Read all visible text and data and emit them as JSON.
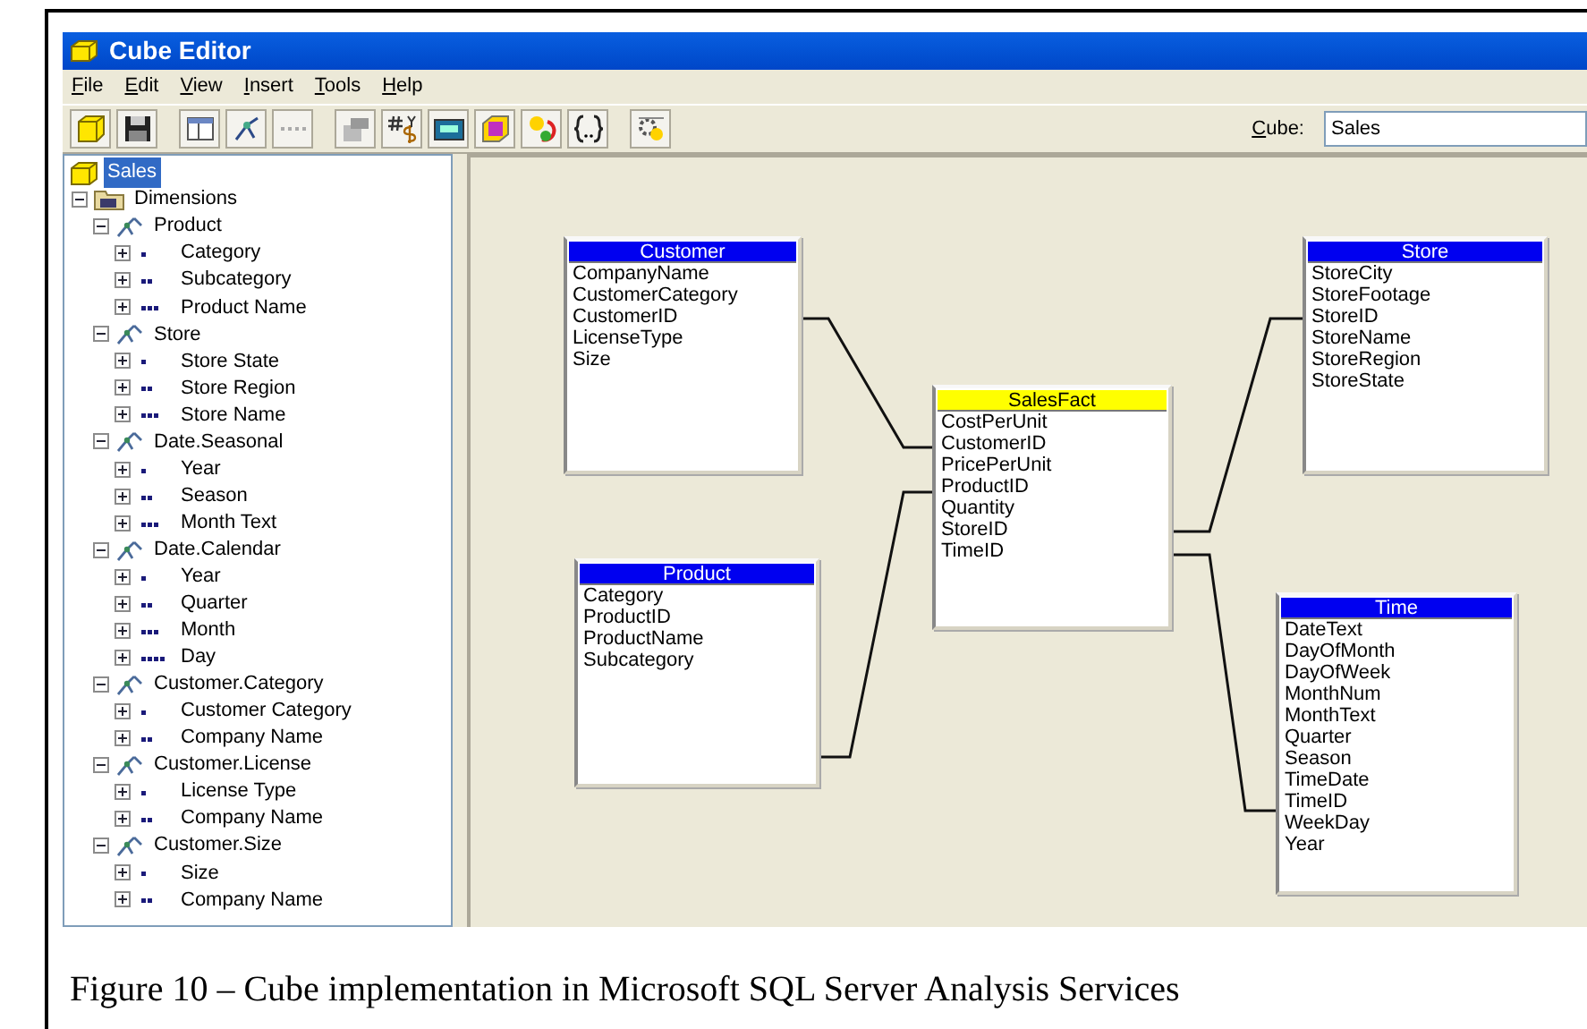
{
  "window": {
    "title": "Cube Editor"
  },
  "menu": [
    "File",
    "Edit",
    "View",
    "Insert",
    "Tools",
    "Help"
  ],
  "toolbar": {
    "cube_label": "Cube:",
    "cube_value": "Sales"
  },
  "tree": [
    {
      "label": "Sales",
      "kind": "cube",
      "selected": true,
      "children": [
        {
          "label": "Dimensions",
          "kind": "folder",
          "selected": false,
          "expanded": true,
          "children": [
            {
              "label": "Product",
              "kind": "dimension",
              "selected": false,
              "expanded": true,
              "children": [
                {
                  "label": "Category",
                  "kind": "level",
                  "selected": false,
                  "expanded": false
                },
                {
                  "label": "Subcategory",
                  "kind": "level",
                  "selected": false,
                  "expanded": false
                },
                {
                  "label": "Product Name",
                  "kind": "level",
                  "selected": false,
                  "expanded": false
                }
              ]
            },
            {
              "label": "Store",
              "kind": "dimension",
              "selected": false,
              "expanded": true,
              "children": [
                {
                  "label": "Store State",
                  "kind": "level",
                  "selected": false,
                  "expanded": false
                },
                {
                  "label": "Store Region",
                  "kind": "level",
                  "selected": false,
                  "expanded": false
                },
                {
                  "label": "Store Name",
                  "kind": "level",
                  "selected": false,
                  "expanded": false
                }
              ]
            },
            {
              "label": "Date.Seasonal",
              "kind": "dimension",
              "selected": false,
              "expanded": true,
              "children": [
                {
                  "label": "Year",
                  "kind": "level",
                  "selected": false,
                  "expanded": false
                },
                {
                  "label": "Season",
                  "kind": "level",
                  "selected": false,
                  "expanded": false
                },
                {
                  "label": "Month Text",
                  "kind": "level",
                  "selected": false,
                  "expanded": false
                }
              ]
            },
            {
              "label": "Date.Calendar",
              "kind": "dimension",
              "selected": false,
              "expanded": true,
              "children": [
                {
                  "label": "Year",
                  "kind": "level",
                  "selected": false,
                  "expanded": false
                },
                {
                  "label": "Quarter",
                  "kind": "level",
                  "selected": false,
                  "expanded": false
                },
                {
                  "label": "Month",
                  "kind": "level",
                  "selected": false,
                  "expanded": false
                },
                {
                  "label": "Day",
                  "kind": "level",
                  "selected": false,
                  "expanded": false
                }
              ]
            },
            {
              "label": "Customer.Category",
              "kind": "dimension",
              "selected": false,
              "expanded": true,
              "children": [
                {
                  "label": "Customer Category",
                  "kind": "level",
                  "selected": false,
                  "expanded": false
                },
                {
                  "label": "Company Name",
                  "kind": "level",
                  "selected": false,
                  "expanded": false
                }
              ]
            },
            {
              "label": "Customer.License",
              "kind": "dimension",
              "selected": false,
              "expanded": true,
              "children": [
                {
                  "label": "License Type",
                  "kind": "level",
                  "selected": false,
                  "expanded": false
                },
                {
                  "label": "Company Name",
                  "kind": "level",
                  "selected": false,
                  "expanded": false
                }
              ]
            },
            {
              "label": "Customer.Size",
              "kind": "dimension",
              "selected": false,
              "expanded": true,
              "children": [
                {
                  "label": "Size",
                  "kind": "level",
                  "selected": false,
                  "expanded": false
                },
                {
                  "label": "Company Name",
                  "kind": "level",
                  "selected": false,
                  "expanded": false
                }
              ]
            }
          ]
        }
      ]
    }
  ],
  "diagram": {
    "tables": [
      {
        "name": "Customer",
        "kind": "dimension",
        "fields": [
          "CompanyName",
          "CustomerCategory",
          "CustomerID",
          "LicenseType",
          "Size"
        ]
      },
      {
        "name": "Store",
        "kind": "dimension",
        "fields": [
          "StoreCity",
          "StoreFootage",
          "StoreID",
          "StoreName",
          "StoreRegion",
          "StoreState"
        ]
      },
      {
        "name": "SalesFact",
        "kind": "fact",
        "fields": [
          "CostPerUnit",
          "CustomerID",
          "PricePerUnit",
          "ProductID",
          "Quantity",
          "StoreID",
          "TimeID"
        ]
      },
      {
        "name": "Product",
        "kind": "dimension",
        "fields": [
          "Category",
          "ProductID",
          "ProductName",
          "Subcategory"
        ]
      },
      {
        "name": "Time",
        "kind": "dimension",
        "fields": [
          "DateText",
          "DayOfMonth",
          "DayOfWeek",
          "MonthNum",
          "MonthText",
          "Quarter",
          "Season",
          "TimeDate",
          "TimeID",
          "WeekDay",
          "Year"
        ]
      }
    ]
  },
  "caption": "Figure 10 – Cube implementation in Microsoft SQL Server Analysis Services"
}
